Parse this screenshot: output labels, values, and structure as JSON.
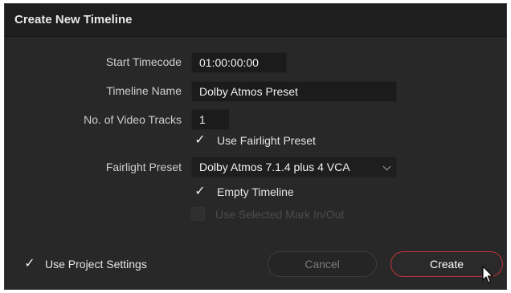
{
  "dialog": {
    "title": "Create New Timeline"
  },
  "form": {
    "start_timecode_label": "Start Timecode",
    "start_timecode_value": "01:00:00:00",
    "timeline_name_label": "Timeline Name",
    "timeline_name_value": "Dolby Atmos Preset",
    "video_tracks_label": "No. of Video Tracks",
    "video_tracks_value": "1",
    "use_fairlight_preset_label": "Use Fairlight Preset",
    "use_fairlight_preset_checked": true,
    "fairlight_preset_label": "Fairlight Preset",
    "fairlight_preset_value": "Dolby Atmos 7.1.4 plus 4 VCA",
    "empty_timeline_label": "Empty Timeline",
    "empty_timeline_checked": true,
    "use_selected_mark_label": "Use Selected Mark In/Out",
    "use_selected_mark_checked": false
  },
  "footer": {
    "use_project_settings_label": "Use Project Settings",
    "use_project_settings_checked": true,
    "cancel_label": "Cancel",
    "create_label": "Create"
  },
  "icons": {
    "check": "checkmark-icon",
    "caret": "chevron-down-icon",
    "cursor": "mouse-pointer-icon"
  },
  "colors": {
    "dialog_bg": "#282828",
    "titlebar_bg": "#1e1e1e",
    "field_bg": "#1b1b1b",
    "create_border": "#c0303a"
  }
}
